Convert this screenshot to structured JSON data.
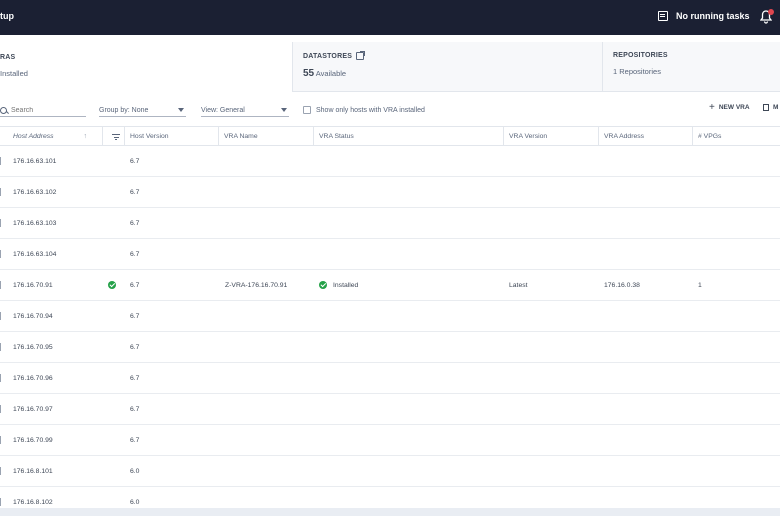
{
  "header": {
    "title": "tup",
    "tasks_label": "No running tasks"
  },
  "cards": {
    "vras": {
      "label": "RAS",
      "value": "Installed"
    },
    "datastores": {
      "label": "DATASTORES",
      "count": "55",
      "value": "Available"
    },
    "repositories": {
      "label": "REPOSITORIES",
      "value": "1 Repositories"
    }
  },
  "toolbar": {
    "search_placeholder": "Search",
    "group_by": "Group by: None",
    "view": "View: General",
    "checkbox_label": "Show only hosts with VRA installed",
    "new_vra": "NEW VRA",
    "more": "M"
  },
  "table": {
    "columns": [
      "Host Address",
      "Host Version",
      "VRA Name",
      "VRA Status",
      "VRA Version",
      "VRA Address",
      "# VPGs"
    ],
    "rows": [
      {
        "host": "176.16.63.101",
        "version": "6.7",
        "vra_name": "",
        "vra_status": "",
        "vra_version": "",
        "vra_address": "",
        "vpgs": ""
      },
      {
        "host": "176.16.63.102",
        "version": "6.7",
        "vra_name": "",
        "vra_status": "",
        "vra_version": "",
        "vra_address": "",
        "vpgs": ""
      },
      {
        "host": "176.16.63.103",
        "version": "6.7",
        "vra_name": "",
        "vra_status": "",
        "vra_version": "",
        "vra_address": "",
        "vpgs": ""
      },
      {
        "host": "176.16.63.104",
        "version": "6.7",
        "vra_name": "",
        "vra_status": "",
        "vra_version": "",
        "vra_address": "",
        "vpgs": ""
      },
      {
        "host": "176.16.70.91",
        "version": "6.7",
        "vra_name": "Z-VRA-176.16.70.91",
        "vra_status": "Installed",
        "vra_version": "Latest",
        "vra_address": "176.16.0.38",
        "vpgs": "1"
      },
      {
        "host": "176.16.70.94",
        "version": "6.7",
        "vra_name": "",
        "vra_status": "",
        "vra_version": "",
        "vra_address": "",
        "vpgs": ""
      },
      {
        "host": "176.16.70.95",
        "version": "6.7",
        "vra_name": "",
        "vra_status": "",
        "vra_version": "",
        "vra_address": "",
        "vpgs": ""
      },
      {
        "host": "176.16.70.96",
        "version": "6.7",
        "vra_name": "",
        "vra_status": "",
        "vra_version": "",
        "vra_address": "",
        "vpgs": ""
      },
      {
        "host": "176.16.70.97",
        "version": "6.7",
        "vra_name": "",
        "vra_status": "",
        "vra_version": "",
        "vra_address": "",
        "vpgs": ""
      },
      {
        "host": "176.16.70.99",
        "version": "6.7",
        "vra_name": "",
        "vra_status": "",
        "vra_version": "",
        "vra_address": "",
        "vpgs": ""
      },
      {
        "host": "176.16.8.101",
        "version": "6.0",
        "vra_name": "",
        "vra_status": "",
        "vra_version": "",
        "vra_address": "",
        "vpgs": ""
      },
      {
        "host": "176.16.8.102",
        "version": "6.0",
        "vra_name": "",
        "vra_status": "",
        "vra_version": "",
        "vra_address": "",
        "vpgs": ""
      }
    ]
  },
  "colors": {
    "header_bg": "#1b2033",
    "ok_green": "#24a148",
    "badge_red": "#e0464f"
  }
}
